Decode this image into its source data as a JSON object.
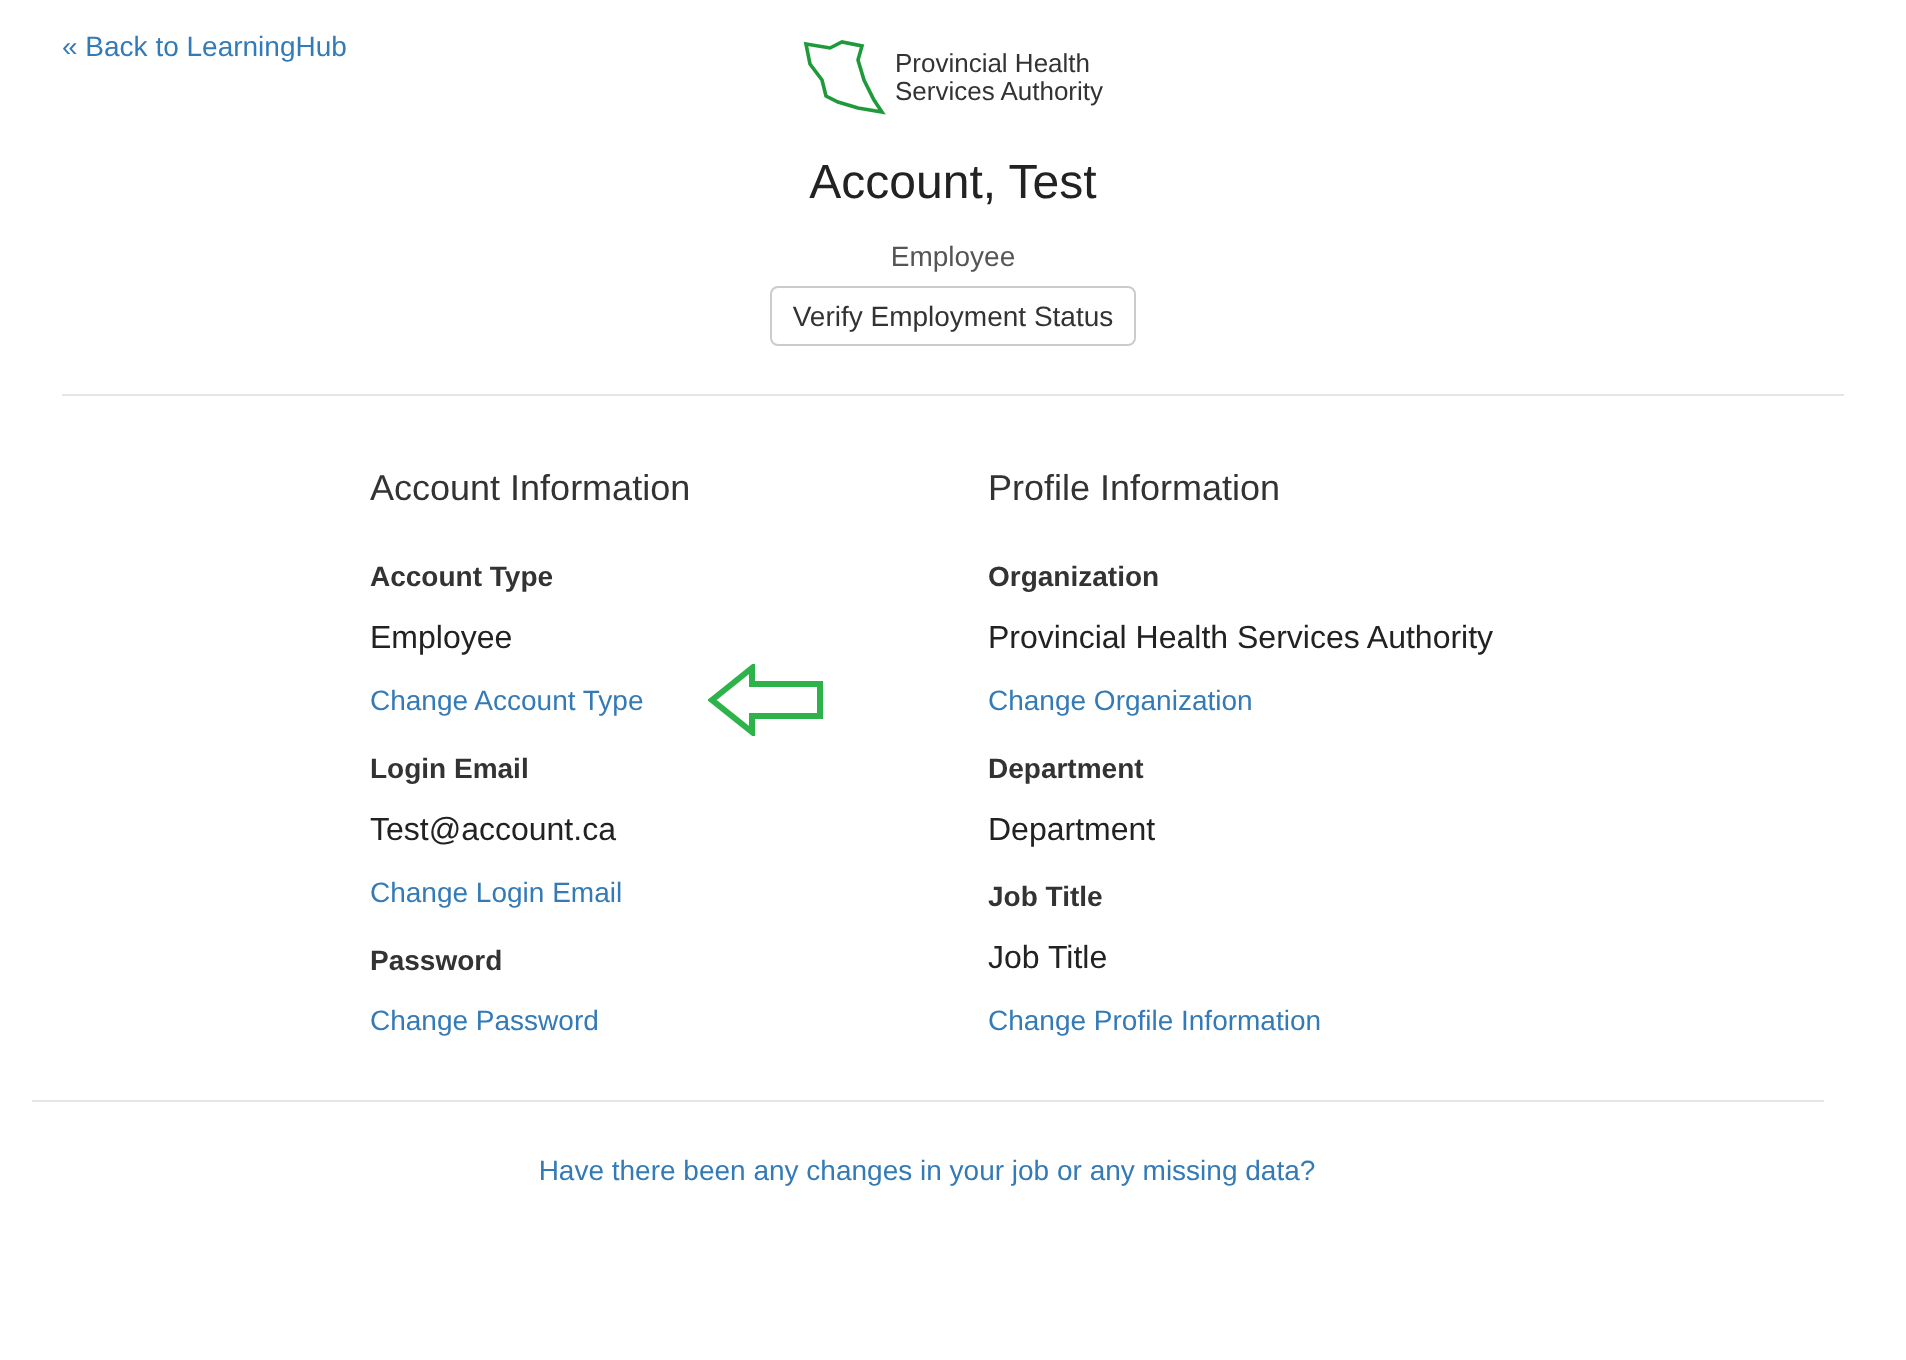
{
  "back_link": "« Back to LearningHub",
  "logo": {
    "line_1": "Provincial Health",
    "line_2": "Services Authority"
  },
  "name": "Account, Test",
  "role": "Employee",
  "verify_button": "Verify Employment Status",
  "sections": [
    {
      "title": "Account Information",
      "items": [
        {
          "kind": "label",
          "text": "Account Type"
        },
        {
          "kind": "value",
          "text": "Employee"
        },
        {
          "kind": "link",
          "text": "Change Account Type",
          "pointed": true
        },
        {
          "kind": "label",
          "text": "Login Email"
        },
        {
          "kind": "value",
          "text": "Test@account.ca"
        },
        {
          "kind": "link",
          "text": "Change Login Email",
          "pointed": false
        },
        {
          "kind": "label",
          "text": "Password"
        },
        {
          "kind": "link",
          "text": "Change Password",
          "pointed": false
        }
      ]
    },
    {
      "title": "Profile Information",
      "items": [
        {
          "kind": "label",
          "text": "Organization"
        },
        {
          "kind": "value",
          "text": "Provincial Health Services Authority"
        },
        {
          "kind": "link",
          "text": "Change Organization",
          "pointed": false
        },
        {
          "kind": "label",
          "text": "Department"
        },
        {
          "kind": "value",
          "text": "Department"
        },
        {
          "kind": "label",
          "text": "Job Title"
        },
        {
          "kind": "value",
          "text": "Job Title"
        },
        {
          "kind": "link",
          "text": "Change Profile Information",
          "pointed": false
        }
      ]
    }
  ],
  "footer_link": "Have there been any changes in your job or any missing data?"
}
